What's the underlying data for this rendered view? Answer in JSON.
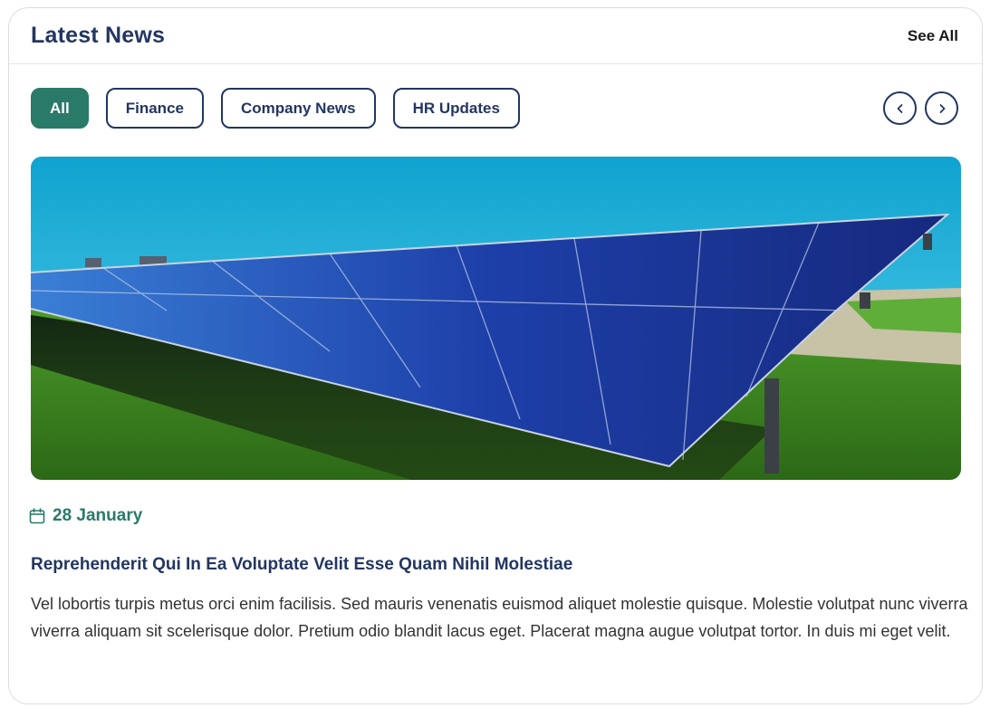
{
  "header": {
    "title": "Latest News",
    "see_all_label": "See All"
  },
  "filters": [
    {
      "label": "All",
      "active": true
    },
    {
      "label": "Finance",
      "active": false
    },
    {
      "label": "Company News",
      "active": false
    },
    {
      "label": "HR Updates",
      "active": false
    }
  ],
  "navigation": {
    "prev_icon": "chevron-left-icon",
    "next_icon": "chevron-right-icon"
  },
  "article": {
    "image": "solar-panel-field-photo",
    "date_icon": "calendar-icon",
    "date": "28 January",
    "title": "Reprehenderit Qui In Ea Voluptate Velit Esse Quam Nihil Molestiae",
    "body": "Vel lobortis turpis metus orci enim facilisis. Sed mauris venenatis euismod aliquet molestie quisque. Molestie volutpat nunc viverra viverra aliquam sit scelerisque dolor. Pretium odio blandit lacus eget. Placerat magna augue volutpat tortor. In duis mi eget velit."
  },
  "colors": {
    "accent": "#2a7a6a",
    "navy": "#233662",
    "border": "#d9dde3"
  }
}
